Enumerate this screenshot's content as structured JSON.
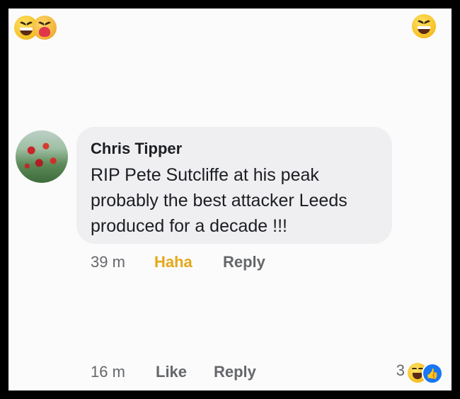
{
  "comment": {
    "author": "Chris Tipper",
    "text": "RIP Pete Sutcliffe at his peak probably the best attacker Leeds produced for a decade !!!",
    "time": "39 m",
    "reaction_label": "Haha",
    "reply_label": "Reply"
  },
  "second_comment": {
    "time": "16 m",
    "like_label": "Like",
    "reply_label": "Reply",
    "reaction_count": "3"
  },
  "colors": {
    "haha_accent": "#e5a819",
    "like_blue": "#1877f2"
  }
}
